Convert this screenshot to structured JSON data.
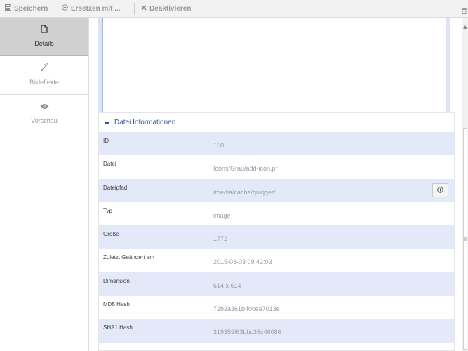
{
  "toolbar": {
    "save_label": "Speichern",
    "replace_label": "Ersetzen mit ...",
    "deactivate_label": "Deaktivieren"
  },
  "sidebar": {
    "items": [
      {
        "label": "Details",
        "icon": "file-icon",
        "active": true
      },
      {
        "label": "Bildeffekte",
        "icon": "magic-wand-icon",
        "active": false
      },
      {
        "label": "Vorschau",
        "icon": "eye-icon",
        "active": false
      }
    ]
  },
  "panel": {
    "title": "Datei Informationen",
    "rows": [
      {
        "key": "ID",
        "value": "150"
      },
      {
        "key": "Datei",
        "value": "Icons/Grau/add-icon.pr"
      },
      {
        "key": "Dateipfad",
        "value": "/media/cache/quiqqer/"
      },
      {
        "key": "Typ",
        "value": "image"
      },
      {
        "key": "Größe",
        "value": "1772"
      },
      {
        "key": "Zuletzt Geändert am",
        "value": "2015-03-03 09:42:03"
      },
      {
        "key": "Dimension",
        "value": "614 x 614"
      },
      {
        "key": "MD5 Hash",
        "value": "72b2a361b40cea7013e"
      },
      {
        "key": "SHA1 Hash",
        "value": "319359f63bbc36c46086"
      }
    ]
  },
  "colors": {
    "accent": "#2f55b0",
    "row_alt": "#e4e9f9",
    "sidebar_active": "#d0d0d0"
  }
}
